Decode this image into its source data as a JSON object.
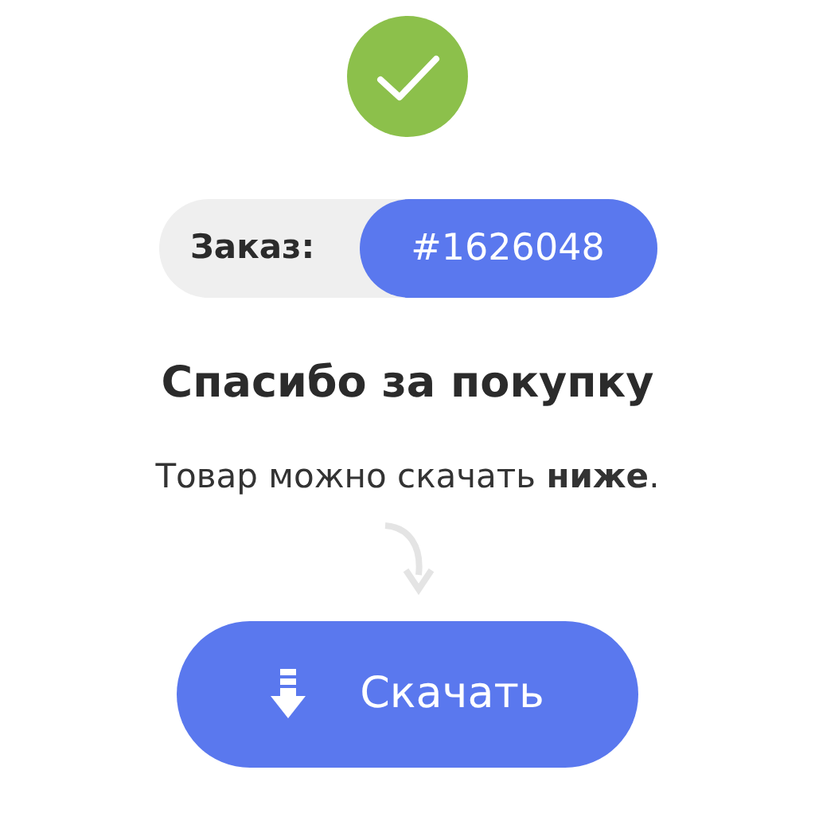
{
  "status": {
    "kind": "success"
  },
  "order": {
    "label": "Заказ:",
    "number": "#1626048"
  },
  "title": "Спасибо за покупку",
  "message": "Товар можно скачать **ниже**.",
  "download_button": {
    "label": "Скачать"
  }
}
